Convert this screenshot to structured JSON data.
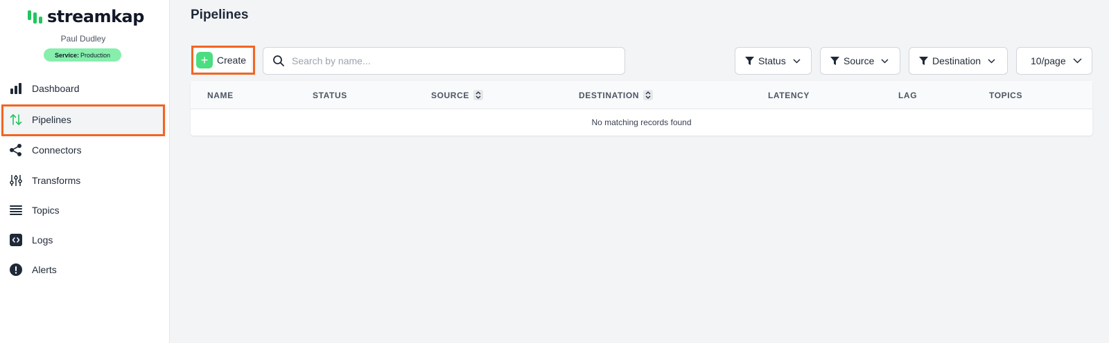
{
  "brand": {
    "name": "streamkap",
    "accent": "#22c55e"
  },
  "user": {
    "name": "Paul Dudley",
    "service_label": "Service:",
    "service_value": "Production"
  },
  "sidebar": {
    "items": [
      {
        "label": "Dashboard",
        "icon": "bar-chart-icon"
      },
      {
        "label": "Pipelines",
        "icon": "arrows-up-down-icon",
        "active": true
      },
      {
        "label": "Connectors",
        "icon": "share-icon"
      },
      {
        "label": "Transforms",
        "icon": "sliders-icon"
      },
      {
        "label": "Topics",
        "icon": "list-icon"
      },
      {
        "label": "Logs",
        "icon": "code-icon"
      },
      {
        "label": "Alerts",
        "icon": "alert-icon"
      }
    ]
  },
  "main": {
    "title": "Pipelines",
    "create_label": "Create",
    "search_placeholder": "Search by name...",
    "filters": {
      "status": "Status",
      "source": "Source",
      "destination": "Destination"
    },
    "page_size": "10/page"
  },
  "table": {
    "columns": [
      "NAME",
      "STATUS",
      "SOURCE",
      "DESTINATION",
      "LATENCY",
      "LAG",
      "TOPICS"
    ],
    "empty_message": "No matching records found"
  },
  "colors": {
    "highlight": "#f26522",
    "create_icon": "#4ade80",
    "badge": "#86efac"
  }
}
